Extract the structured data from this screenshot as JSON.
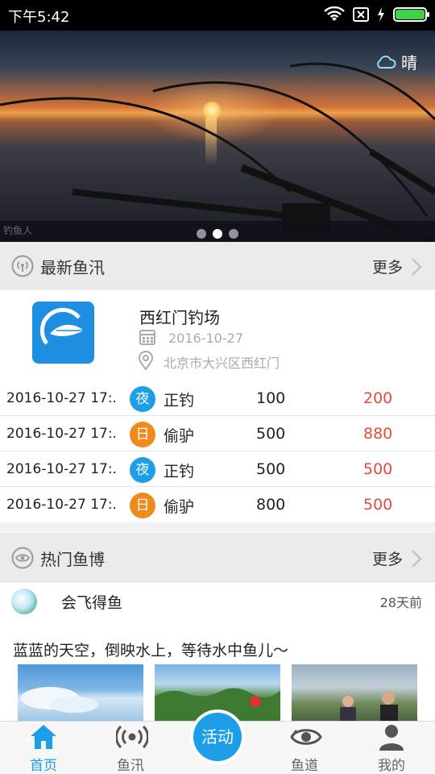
{
  "status_bar": {
    "time": "下午5:42"
  },
  "banner": {
    "weather": "晴",
    "watermark": "钓鱼人",
    "active_dot": 1
  },
  "news_section": {
    "title": "最新鱼汛",
    "more": "更多"
  },
  "spot": {
    "name": "西红门钓场",
    "date": "2016-10-27",
    "address": "北京市大兴区西红门"
  },
  "catch_rows": [
    {
      "date": "2016-10-27 17:.",
      "badge": "夜",
      "type": "night",
      "kind": "正钓",
      "v1": "100",
      "v2": "200"
    },
    {
      "date": "2016-10-27 17:.",
      "badge": "日",
      "type": "day",
      "kind": "偷驴",
      "v1": "500",
      "v2": "880"
    },
    {
      "date": "2016-10-27 17:.",
      "badge": "夜",
      "type": "night",
      "kind": "正钓",
      "v1": "500",
      "v2": "500"
    },
    {
      "date": "2016-10-27 17:.",
      "badge": "日",
      "type": "day",
      "kind": "偷驴",
      "v1": "800",
      "v2": "500"
    }
  ],
  "blog_section": {
    "title": "热门鱼博",
    "more": "更多"
  },
  "blog_post": {
    "author": "会飞得鱼",
    "ago": "28天前",
    "text": "蓝蓝的天空，倒映水上，等待水中鱼儿～"
  },
  "tabs": {
    "home": "首页",
    "news": "鱼汛",
    "activity": "活动",
    "spots": "鱼道",
    "me": "我的"
  },
  "colors": {
    "accent": "#1c9fe8",
    "orange": "#f08a1c",
    "red": "#e14b3b"
  }
}
